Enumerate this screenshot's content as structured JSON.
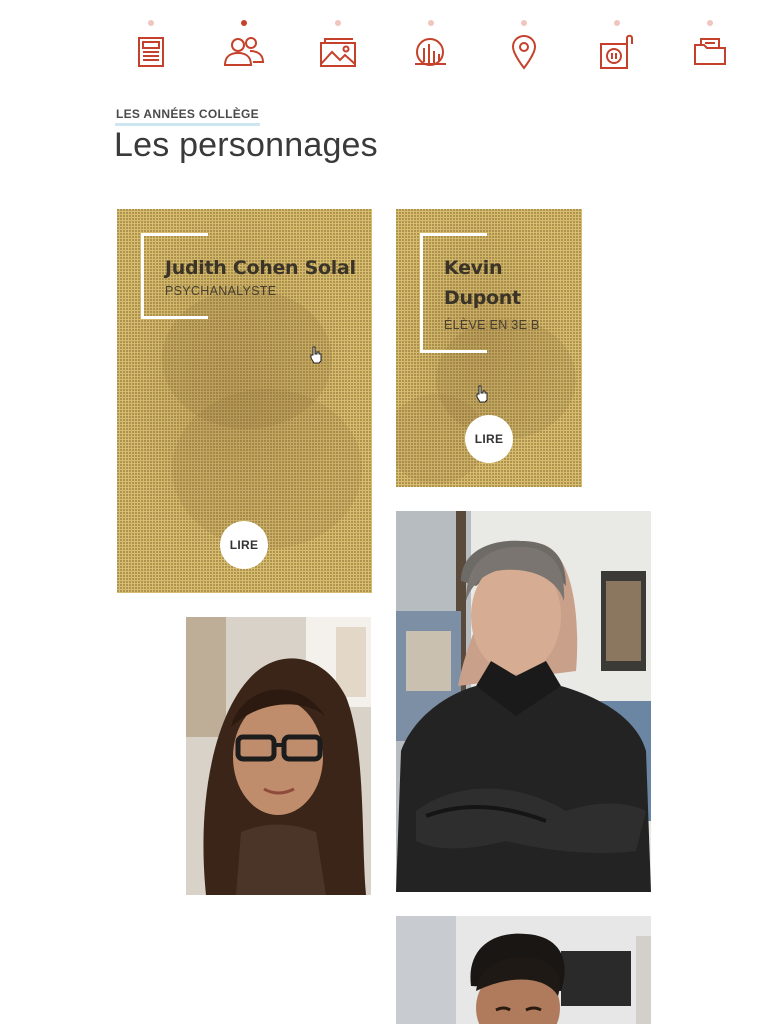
{
  "nav": {
    "items": [
      {
        "icon": "newspaper-icon",
        "active": false
      },
      {
        "icon": "people-icon",
        "active": true
      },
      {
        "icon": "images-icon",
        "active": false
      },
      {
        "icon": "chart-icon",
        "active": false
      },
      {
        "icon": "map-pin-icon",
        "active": false
      },
      {
        "icon": "audio-player-icon",
        "active": false
      },
      {
        "icon": "folder-icon",
        "active": false
      }
    ],
    "accent_color": "#c6412b",
    "inactive_dot_color": "#f1c5be"
  },
  "section": {
    "kicker": "LES ANNÉES COLLÈGE",
    "title": "Les personnages"
  },
  "cards": [
    {
      "name": "Judith Cohen Solal",
      "role": "PSYCHANALYSTE",
      "button": "LIRE"
    },
    {
      "name": "Kevin Dupont",
      "name_line1": "Kevin",
      "name_line2": "Dupont",
      "role": "ÉLÈVE EN 3E B",
      "button": "LIRE"
    }
  ],
  "photos": [
    {
      "subject": "young-woman-with-glasses-photo"
    },
    {
      "subject": "man-arms-crossed-photo"
    },
    {
      "subject": "young-man-photo"
    }
  ],
  "colors": {
    "card_background": "#d8bd6f",
    "kicker_underline": "#cde6f0"
  }
}
